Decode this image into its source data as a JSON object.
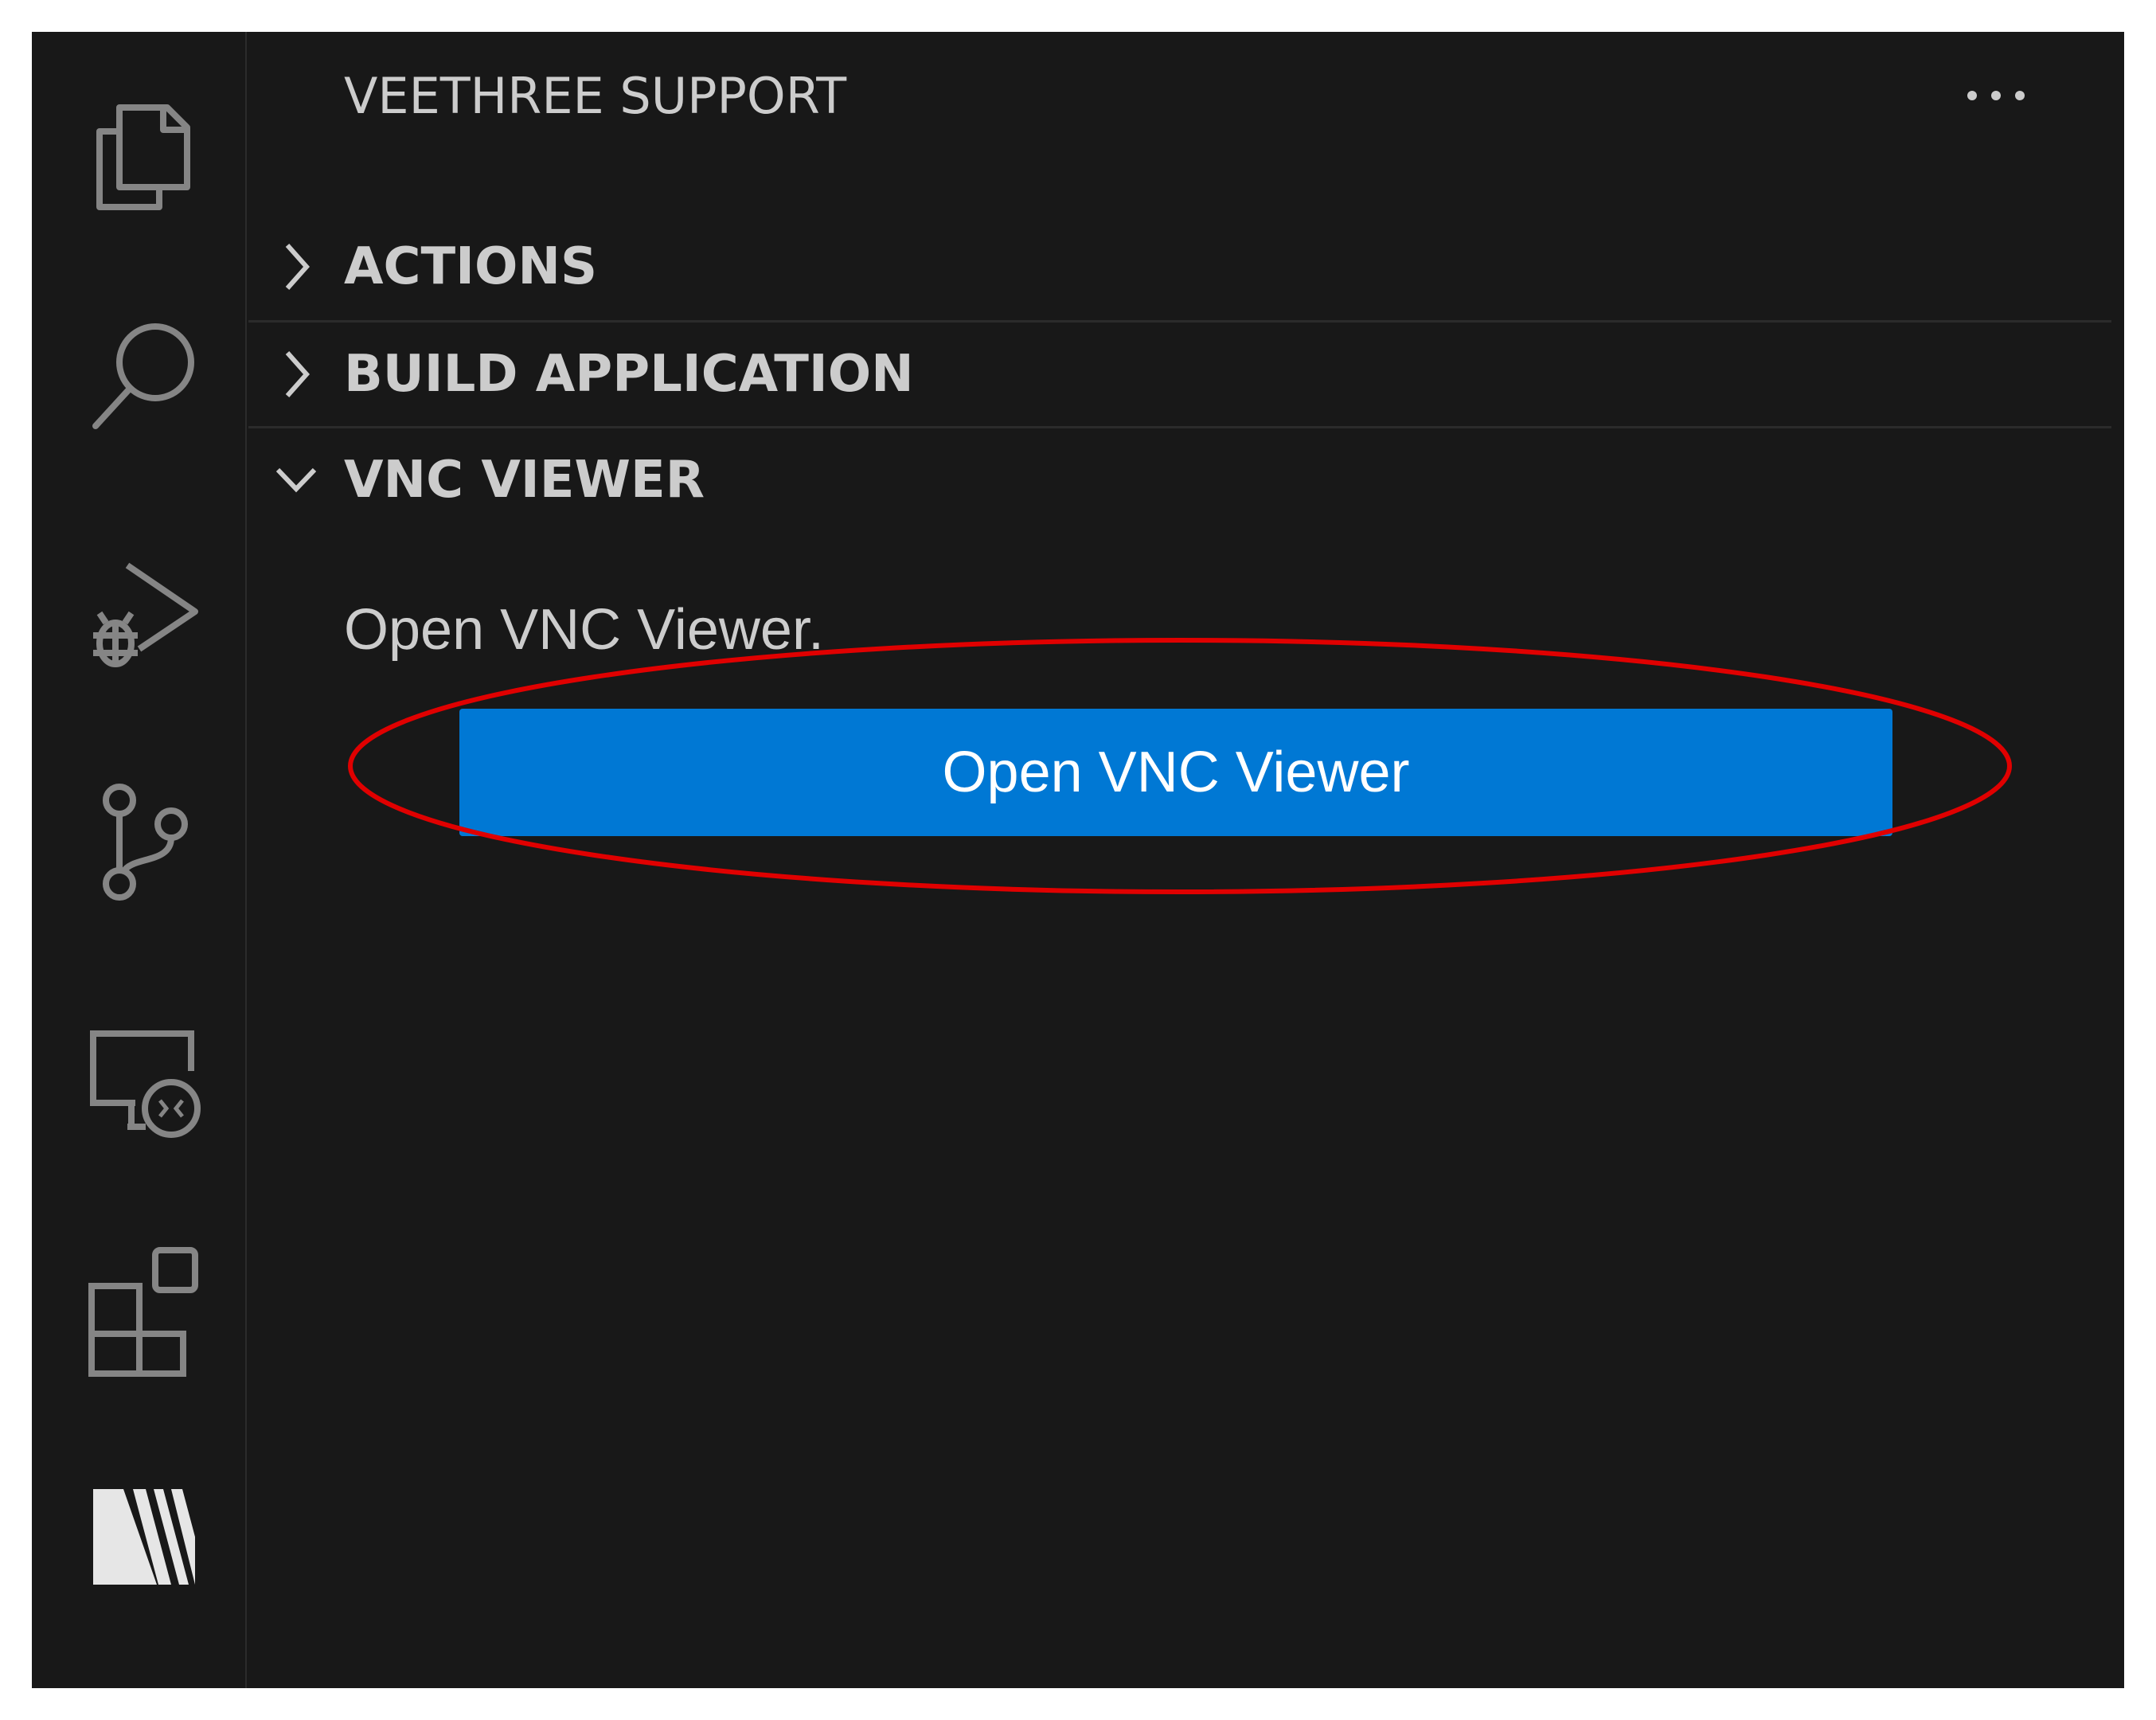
{
  "sidebar": {
    "title": "VEETHREE SUPPORT",
    "more_actions_label": "More Actions"
  },
  "sections": [
    {
      "label": "ACTIONS",
      "expanded": false
    },
    {
      "label": "BUILD APPLICATION",
      "expanded": false
    },
    {
      "label": "VNC VIEWER",
      "expanded": true
    }
  ],
  "vnc_view": {
    "message": "Open VNC Viewer.",
    "button_label": "Open VNC Viewer"
  },
  "activity_bar": {
    "icons": [
      "explorer-icon",
      "search-icon",
      "run-and-debug-icon",
      "source-control-icon",
      "remote-explorer-icon",
      "extensions-icon",
      "veethree-icon"
    ]
  },
  "colors": {
    "background": "#181818",
    "foreground": "#cccccc",
    "button": "#0078d4",
    "annotation": "#e00000"
  }
}
